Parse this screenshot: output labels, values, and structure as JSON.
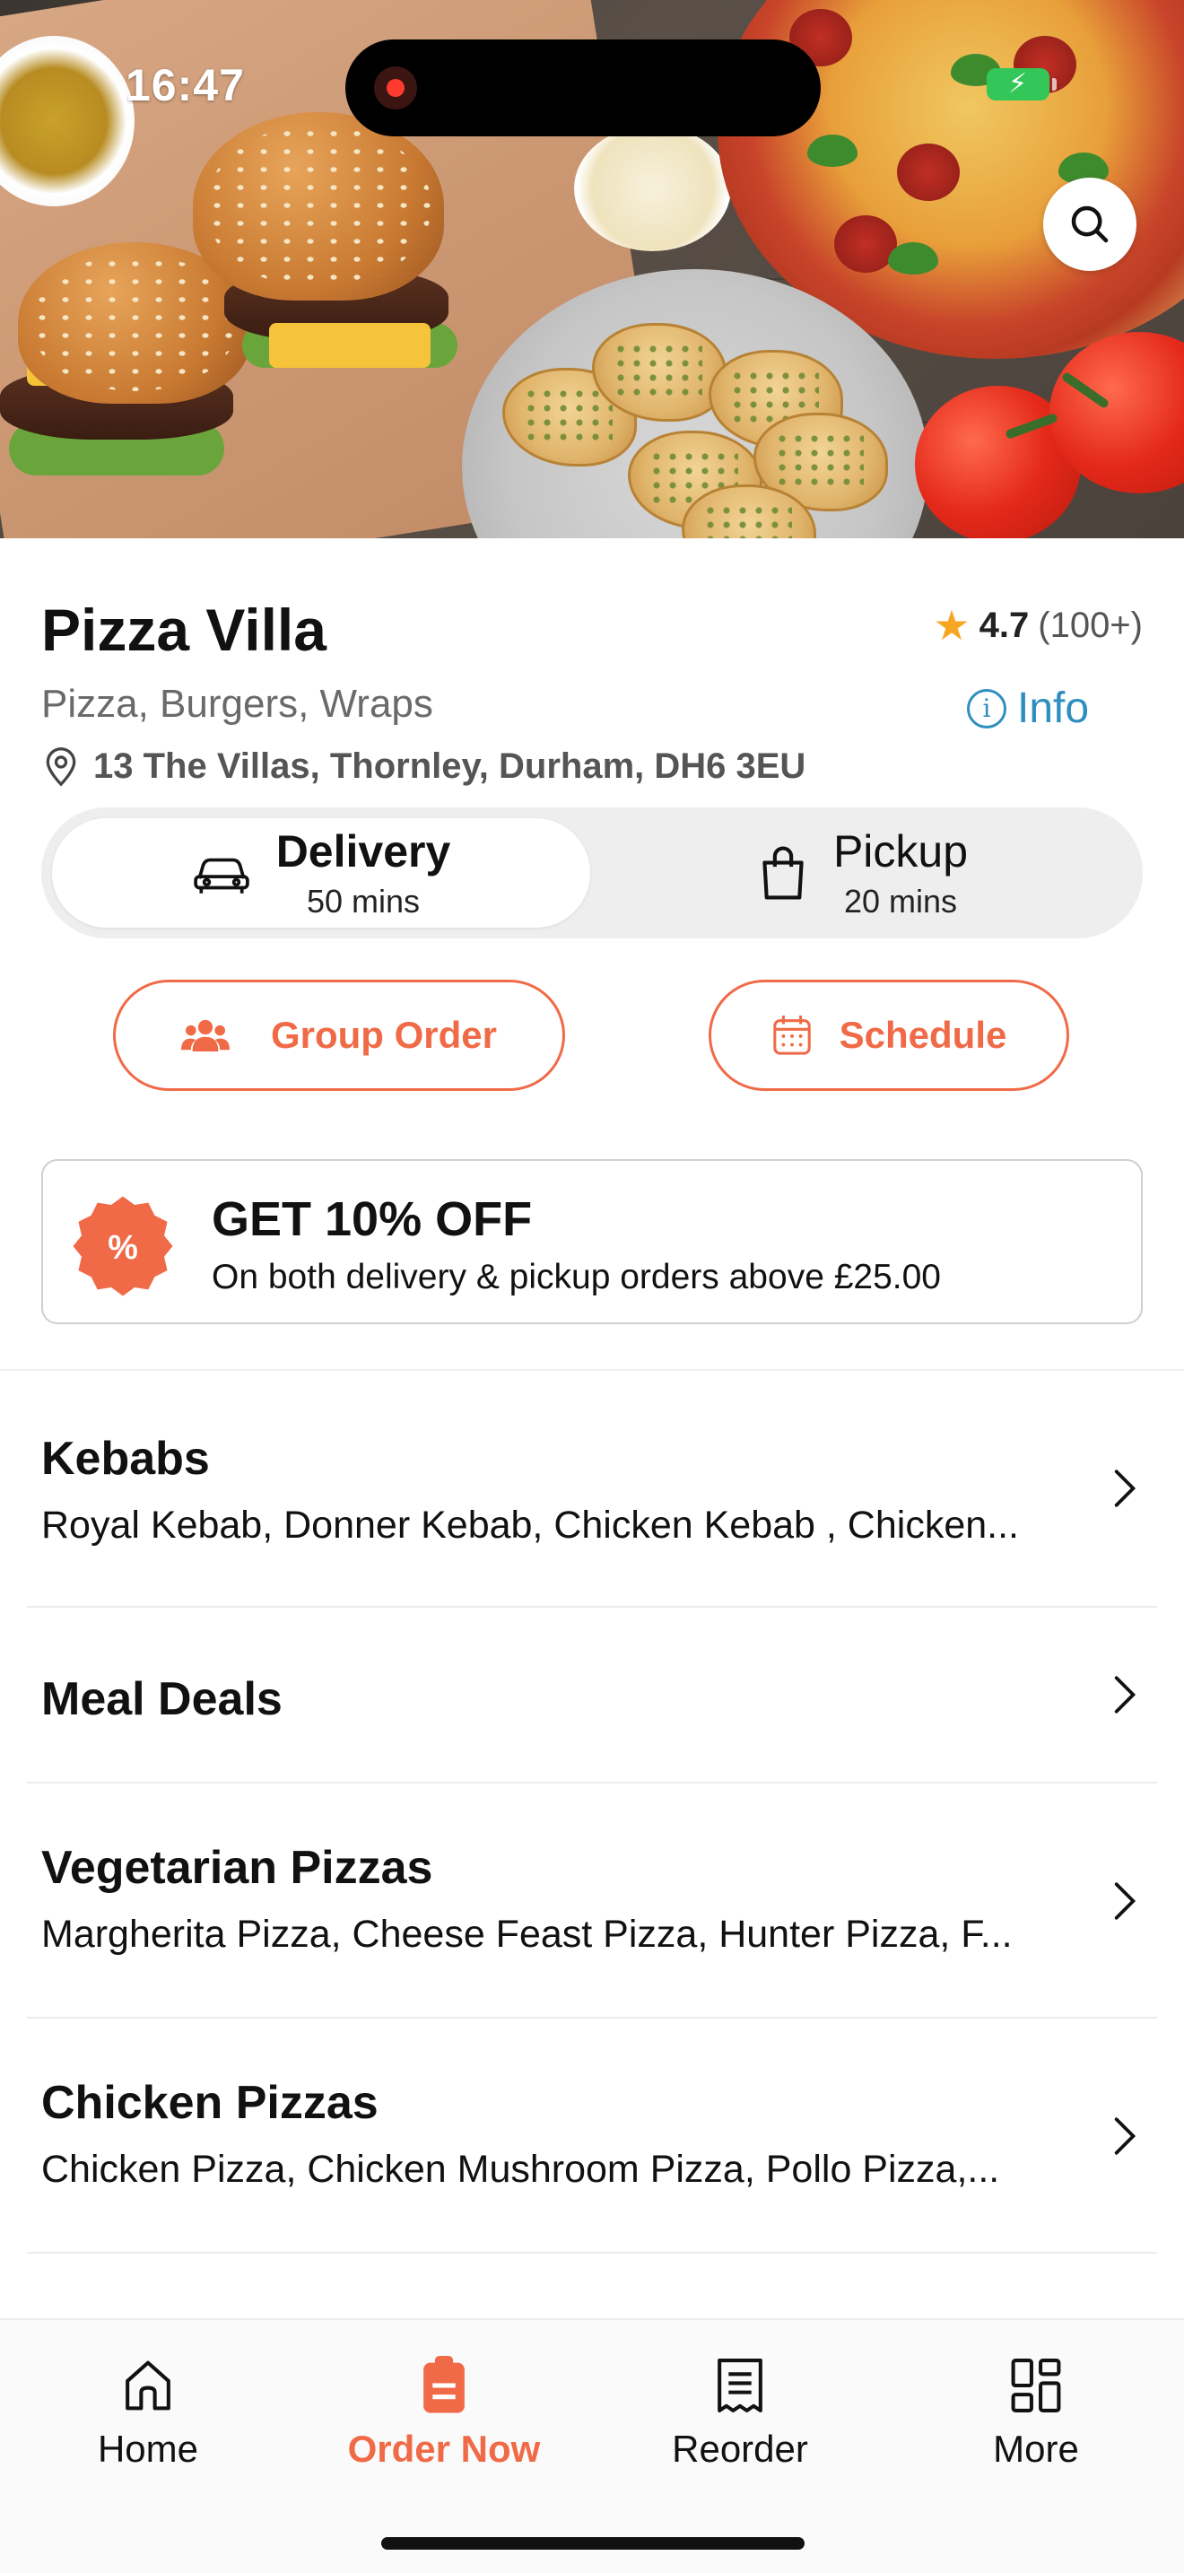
{
  "status_bar": {
    "time": "16:47"
  },
  "restaurant": {
    "name": "Pizza Villa",
    "rating": "4.7",
    "rating_count": "(100+)",
    "cuisines": "Pizza, Burgers, Wraps",
    "info_label": "Info",
    "address": "13 The Villas, Thornley, Durham, DH6 3EU"
  },
  "order_mode": {
    "delivery": {
      "label": "Delivery",
      "time": "50 mins",
      "selected": true
    },
    "pickup": {
      "label": "Pickup",
      "time": "20 mins",
      "selected": false
    }
  },
  "actions": {
    "group_order": "Group Order",
    "schedule": "Schedule"
  },
  "promo": {
    "title": "GET 10% OFF",
    "text": "On both delivery & pickup orders above £25.00"
  },
  "categories": [
    {
      "name": "Kebabs",
      "items": "Royal Kebab, Donner Kebab, Chicken Kebab , Chicken..."
    },
    {
      "name": "Meal Deals",
      "items": ""
    },
    {
      "name": "Vegetarian Pizzas",
      "items": "Margherita Pizza, Cheese Feast Pizza, Hunter Pizza, F..."
    },
    {
      "name": "Chicken Pizzas",
      "items": "Chicken Pizza, Chicken Mushroom Pizza, Pollo Pizza,..."
    }
  ],
  "tabs": [
    {
      "label": "Home",
      "icon": "home-icon",
      "active": false
    },
    {
      "label": "Order Now",
      "icon": "order-icon",
      "active": true
    },
    {
      "label": "Reorder",
      "icon": "receipt-icon",
      "active": false
    },
    {
      "label": "More",
      "icon": "grid-icon",
      "active": false
    }
  ],
  "colors": {
    "accent": "#f06a47",
    "info": "#2e8fbf",
    "star": "#f6a623"
  }
}
